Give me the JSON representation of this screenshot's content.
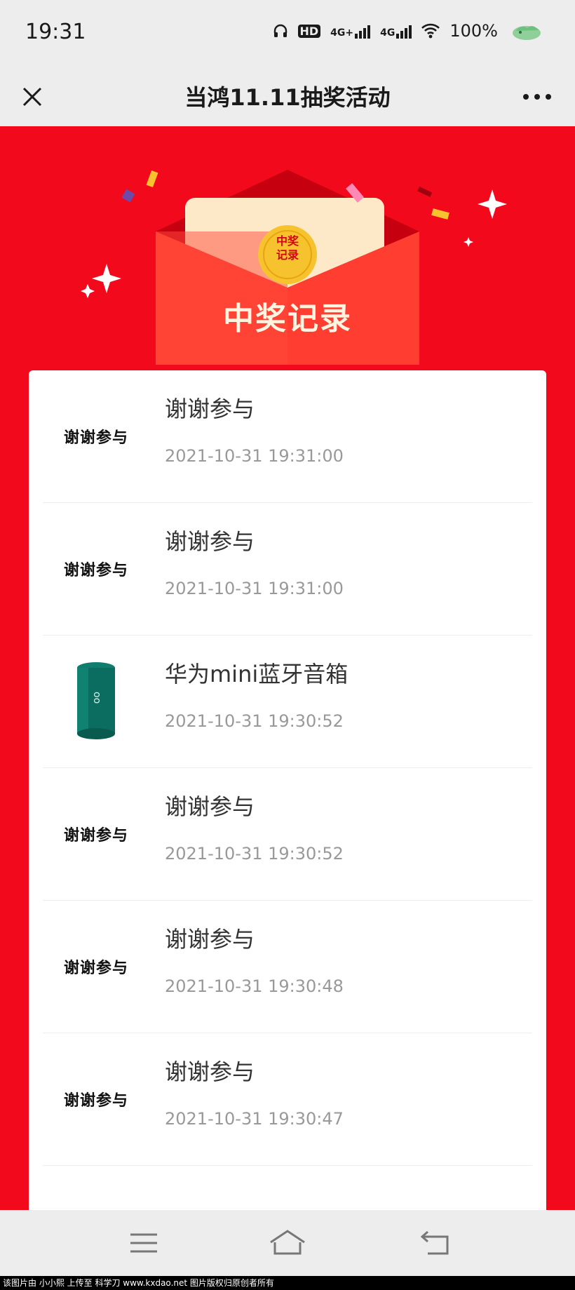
{
  "status_bar": {
    "time": "19:31",
    "hd_label": "HD",
    "net1_label": "4G+",
    "net2_label": "4G",
    "battery": "100%"
  },
  "nav": {
    "title": "当鸿11.11抽奖活动",
    "close_icon": "close-icon",
    "more_icon": "more-icon"
  },
  "banner": {
    "title": "中奖记录",
    "badge_text": "中奖\n记录",
    "colors": {
      "page_bg": "#f2091c",
      "envelope": "#ff3b2f",
      "badge": "#f6c22d"
    }
  },
  "records": [
    {
      "thumb": "谢谢参与",
      "name": "谢谢参与",
      "time": "2021-10-31 19:31:00"
    },
    {
      "thumb": "谢谢参与",
      "name": "谢谢参与",
      "time": "2021-10-31 19:31:00"
    },
    {
      "thumb": "speaker-image",
      "name": "华为mini蓝牙音箱",
      "time": "2021-10-31 19:30:52"
    },
    {
      "thumb": "谢谢参与",
      "name": "谢谢参与",
      "time": "2021-10-31 19:30:52"
    },
    {
      "thumb": "谢谢参与",
      "name": "谢谢参与",
      "time": "2021-10-31 19:30:48"
    },
    {
      "thumb": "谢谢参与",
      "name": "谢谢参与",
      "time": "2021-10-31 19:30:47"
    }
  ],
  "bottom_nav": {
    "menu_icon": "menu-icon",
    "home_icon": "home-icon",
    "back_icon": "back-icon"
  },
  "watermark": "该图片由 小小熙 上传至 科学刀 www.kxdao.net 图片版权归原创者所有"
}
